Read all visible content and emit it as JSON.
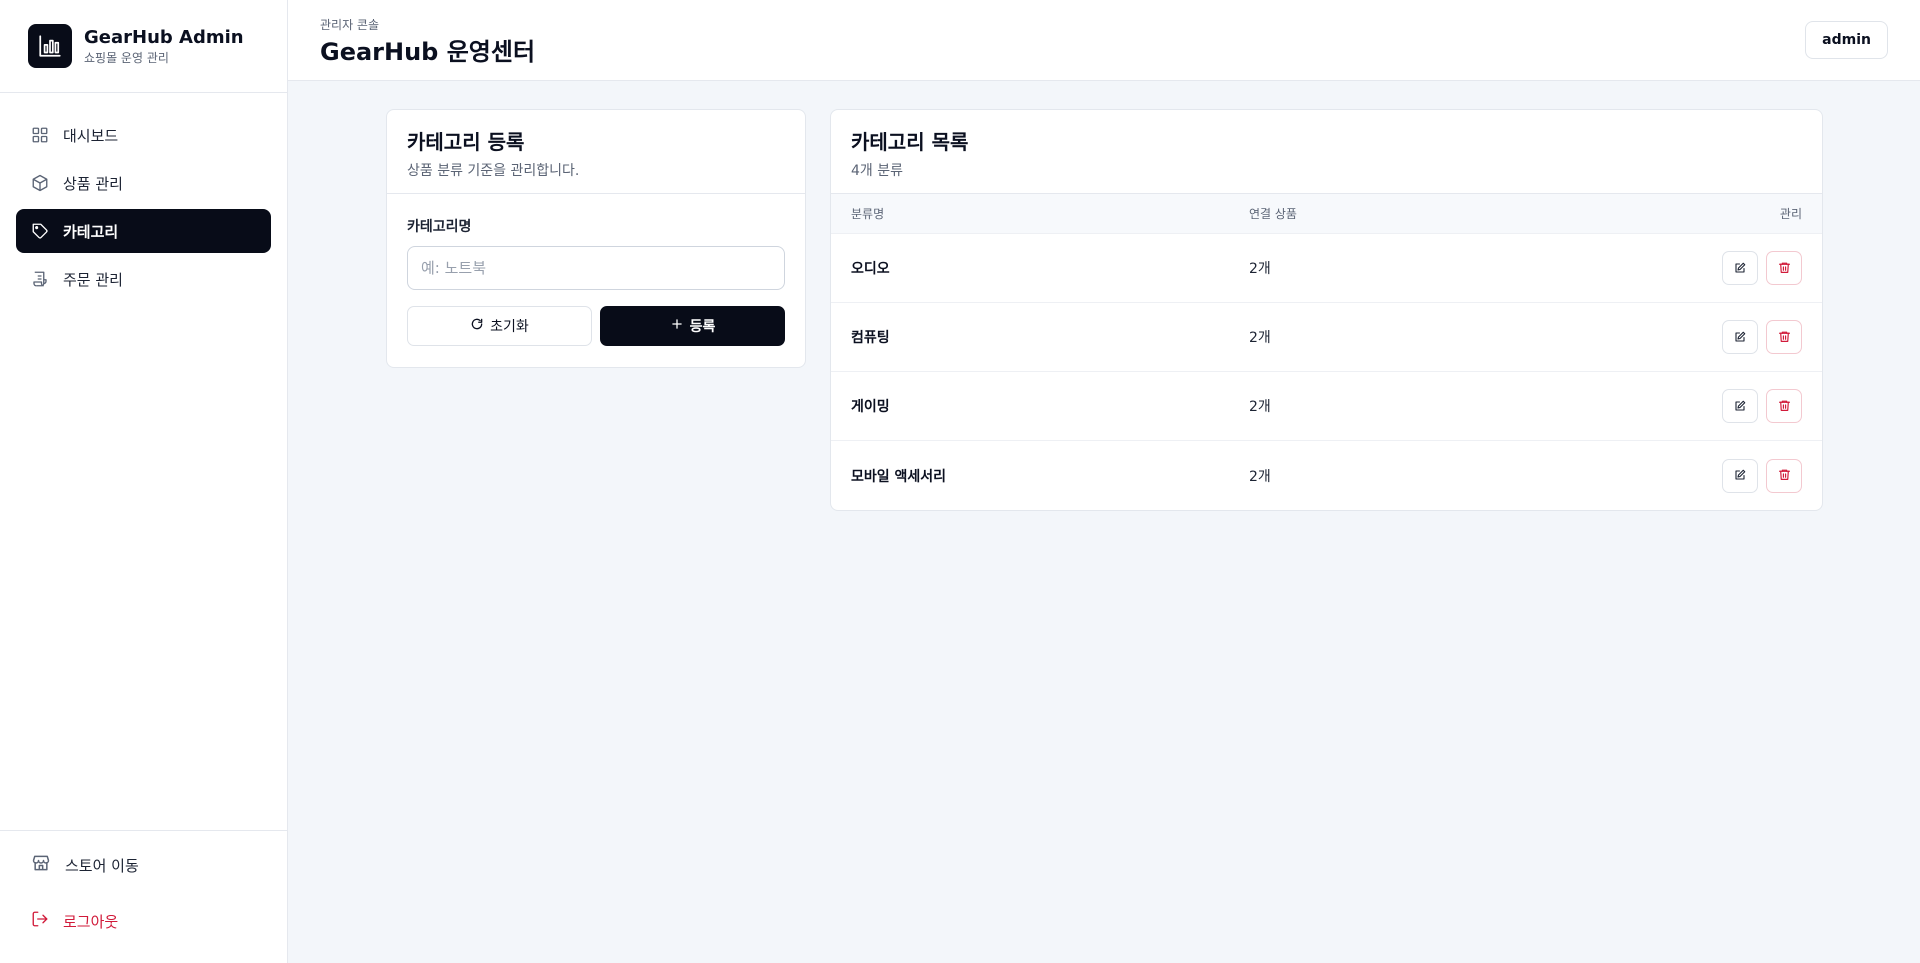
{
  "brand": {
    "title": "GearHub Admin",
    "subtitle": "쇼핑몰 운영 관리",
    "logo_icon": "bar-chart-icon"
  },
  "sidebar": {
    "items": [
      {
        "label": "대시보드",
        "icon": "grid-icon",
        "active": false
      },
      {
        "label": "상품 관리",
        "icon": "box-icon",
        "active": false
      },
      {
        "label": "카테고리",
        "icon": "tag-icon",
        "active": true
      },
      {
        "label": "주문 관리",
        "icon": "receipt-icon",
        "active": false
      }
    ],
    "bottom": [
      {
        "label": "스토어 이동",
        "icon": "store-icon"
      },
      {
        "label": "로그아웃",
        "icon": "logout-icon"
      }
    ]
  },
  "header": {
    "eyebrow": "관리자 콘솔",
    "title": "GearHub 운영센터",
    "user": "admin"
  },
  "form": {
    "title": "카테고리 등록",
    "subtitle": "상품 분류 기준을 관리합니다.",
    "field_label": "카테고리명",
    "input_value": "",
    "input_placeholder": "예: 노트북",
    "reset_label": "초기화",
    "submit_label": "등록"
  },
  "list": {
    "title": "카테고리 목록",
    "subtitle": "4개 분류",
    "columns": [
      "분류명",
      "연결 상품",
      "관리"
    ],
    "rows": [
      {
        "name": "오디오",
        "count": "2개"
      },
      {
        "name": "컴퓨팅",
        "count": "2개"
      },
      {
        "name": "게이밍",
        "count": "2개"
      },
      {
        "name": "모바일 액세서리",
        "count": "2개"
      }
    ]
  },
  "colors": {
    "accent": "#080c18",
    "danger": "#d11a3a",
    "background": "#f3f6fa"
  }
}
